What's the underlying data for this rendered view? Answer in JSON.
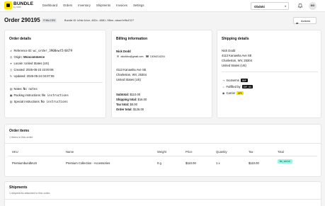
{
  "brand": {
    "title": "BUNDLE",
    "subtitle": "by CRP"
  },
  "nav": [
    "Dashboard",
    "Orders",
    "Inventory",
    "Shipments",
    "Invoices",
    "Settings"
  ],
  "store": {
    "selected": "Obdoki"
  },
  "user": {
    "initials": "MG"
  },
  "order": {
    "title": "Order 290195",
    "status": "FINALIZED",
    "bundle_id_label": "Bundle ID:",
    "bundle_id": "b5dc1dce-482c-4881-98ee-abaafe9b4327",
    "actions_label": "Actions"
  },
  "order_details": {
    "title": "Order details",
    "reference_label": "Reference ID:",
    "reference_value": "wc_order_3908ewt5r0479",
    "origin_label": "Origin:",
    "origin_value": "Woocommerce",
    "locale_label": "Locale:",
    "locale_value": "United States (US)",
    "created_label": "Created:",
    "created_value": "2025-05-23 23:00:06",
    "updated_label": "Updated:",
    "updated_value": "2025-05-24 03:07:06",
    "notes_label": "Notes:",
    "notes_value": "No notes",
    "packing_label": "Packing instructions:",
    "packing_value": "No instructions",
    "special_label": "Special instructions:",
    "special_value": "No instructions"
  },
  "billing": {
    "title": "Billing information",
    "name": "Nick Dodd",
    "email": "ddoddco@gmail.com",
    "phone": "13044214216",
    "address1": "4113 Kanawha Ave SE",
    "address2": "Charleston, WV, 25304",
    "country": "United States (US)",
    "subtotal_label": "Subtotal:",
    "subtotal_value": "$110.00",
    "shipping_label": "Shipping total:",
    "shipping_value": "$16.00",
    "tax_label": "Tax total:",
    "tax_value": "$0.00",
    "order_total_label": "Order total:",
    "order_total_value": "$126.00"
  },
  "shipping": {
    "title": "Shipping details",
    "name": "Nick Dodd",
    "address1": "4113 Kanawha Ave SE",
    "address2": "Charleston, WV, 25304",
    "country": "United States (US)",
    "incoterms_label": "Incoterms",
    "incoterms_value": "DDP",
    "fulfilled_label": "Fulfilled by",
    "fulfilled_value": "CRP_US",
    "carrier_label": "Carrier",
    "carrier_value": "UPS"
  },
  "items": {
    "title": "Order items",
    "subtitle": "1 items in this order.",
    "columns": [
      "SKU",
      "Name",
      "Weight",
      "Price",
      "Quantity",
      "Tax",
      "Total"
    ],
    "rows": [
      {
        "sku": "PremiumbundleUS",
        "name": "Premium Collection - Accessories",
        "weight": "0 g",
        "price": "$110.00",
        "quantity": "1 x",
        "tax": "$110.00",
        "total": "No_match"
      }
    ]
  },
  "shipments": {
    "title": "Shipments",
    "subtitle": "1 shipments attached to this order."
  },
  "colors": {
    "accent": "#ffe500",
    "total_badge": "#99f6e4"
  },
  "icons": [
    "box-logo-icon",
    "chevron-down-icon",
    "bell-icon",
    "actions-icon",
    "hash-icon",
    "globe-icon",
    "location-icon",
    "clock-icon",
    "refresh-icon",
    "note-icon",
    "package-icon",
    "mail-icon",
    "phone-icon",
    "truck-icon",
    "warehouse-icon",
    "carrier-icon"
  ]
}
